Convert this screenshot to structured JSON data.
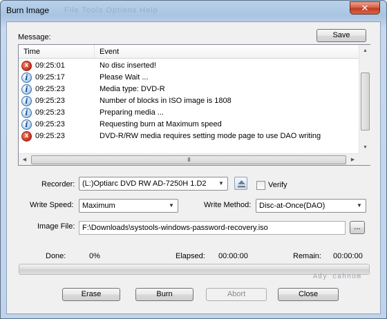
{
  "window": {
    "title": "Burn Image",
    "ghost_menu": "File    Tools    Options    Help",
    "close_glyph": "✕"
  },
  "message": {
    "label": "Message:",
    "save_label": "Save",
    "columns": {
      "time": "Time",
      "event": "Event"
    },
    "rows": [
      {
        "type": "error",
        "time": "09:25:01",
        "event": "No disc inserted!"
      },
      {
        "type": "info",
        "time": "09:25:17",
        "event": "Please Wait ..."
      },
      {
        "type": "info",
        "time": "09:25:23",
        "event": "Media type: DVD-R"
      },
      {
        "type": "info",
        "time": "09:25:23",
        "event": "Number of blocks in ISO image is 1808"
      },
      {
        "type": "info",
        "time": "09:25:23",
        "event": "Preparing media ..."
      },
      {
        "type": "info",
        "time": "09:25:23",
        "event": "Requesting burn at Maximum speed"
      },
      {
        "type": "error",
        "time": "09:25:23",
        "event": "DVD-R/RW media requires setting mode page to use DAO writing"
      }
    ],
    "icons": {
      "error": "x",
      "info": "i"
    }
  },
  "recorder": {
    "label": "Recorder:",
    "value": "(L:)Optiarc DVD RW AD-7250H 1.D2",
    "eject_icon": "eject-icon",
    "verify_label": "Verify",
    "verify_checked": false
  },
  "write_speed": {
    "label": "Write Speed:",
    "value": "Maximum"
  },
  "write_method": {
    "label": "Write Method:",
    "value": "Disc-at-Once(DAO)"
  },
  "image_file": {
    "label": "Image File:",
    "value": "F:\\Downloads\\systools-windows-password-recovery.iso",
    "browse_label": "..."
  },
  "status": {
    "done_label": "Done:",
    "done_value": "0%",
    "elapsed_label": "Elapsed:",
    "elapsed_value": "00:00:00",
    "remain_label": "Remain:",
    "remain_value": "00:00:00",
    "progress_fraction": 0
  },
  "watermark": "Ady cahnom",
  "buttons": {
    "erase": "Erase",
    "burn": "Burn",
    "abort": "Abort",
    "close": "Close"
  },
  "scroll": {
    "up": "▲",
    "down": "▼",
    "left": "◀",
    "right": "▶",
    "grip": "III"
  }
}
